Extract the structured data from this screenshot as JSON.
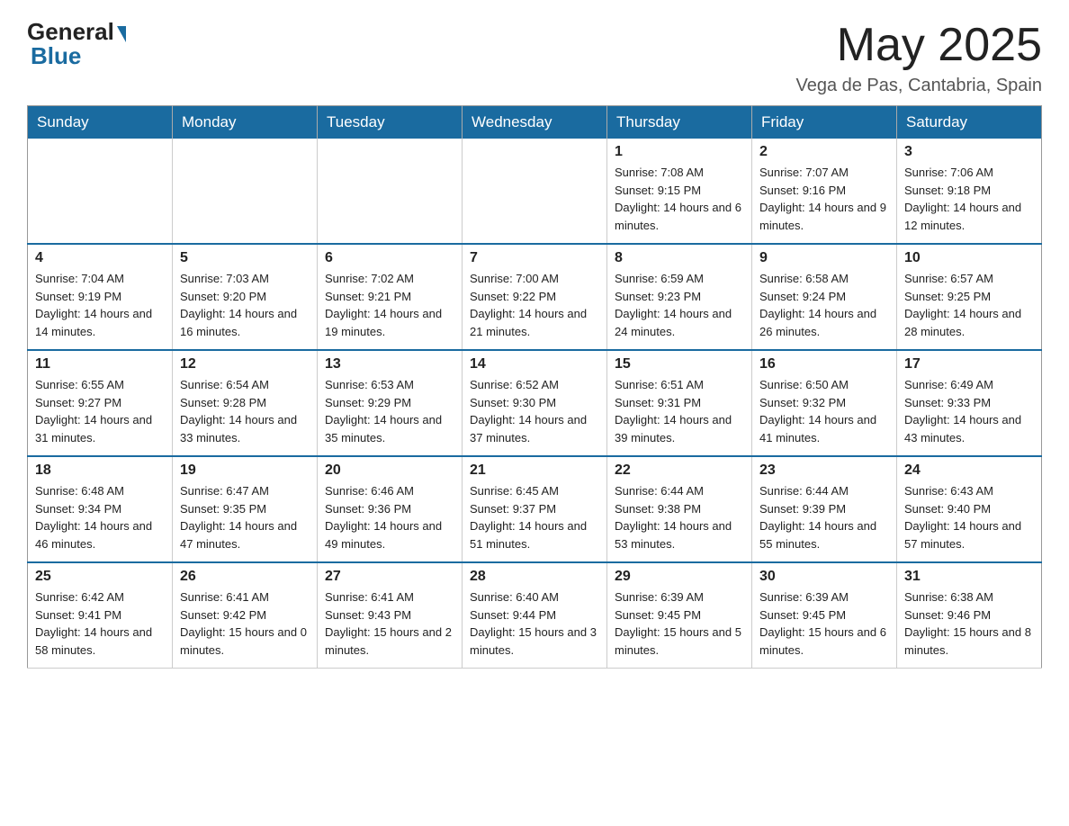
{
  "header": {
    "logo_general": "General",
    "logo_blue": "Blue",
    "main_title": "May 2025",
    "subtitle": "Vega de Pas, Cantabria, Spain"
  },
  "calendar": {
    "days_of_week": [
      "Sunday",
      "Monday",
      "Tuesday",
      "Wednesday",
      "Thursday",
      "Friday",
      "Saturday"
    ],
    "weeks": [
      [
        {
          "day": "",
          "info": ""
        },
        {
          "day": "",
          "info": ""
        },
        {
          "day": "",
          "info": ""
        },
        {
          "day": "",
          "info": ""
        },
        {
          "day": "1",
          "info": "Sunrise: 7:08 AM\nSunset: 9:15 PM\nDaylight: 14 hours and 6 minutes."
        },
        {
          "day": "2",
          "info": "Sunrise: 7:07 AM\nSunset: 9:16 PM\nDaylight: 14 hours and 9 minutes."
        },
        {
          "day": "3",
          "info": "Sunrise: 7:06 AM\nSunset: 9:18 PM\nDaylight: 14 hours and 12 minutes."
        }
      ],
      [
        {
          "day": "4",
          "info": "Sunrise: 7:04 AM\nSunset: 9:19 PM\nDaylight: 14 hours and 14 minutes."
        },
        {
          "day": "5",
          "info": "Sunrise: 7:03 AM\nSunset: 9:20 PM\nDaylight: 14 hours and 16 minutes."
        },
        {
          "day": "6",
          "info": "Sunrise: 7:02 AM\nSunset: 9:21 PM\nDaylight: 14 hours and 19 minutes."
        },
        {
          "day": "7",
          "info": "Sunrise: 7:00 AM\nSunset: 9:22 PM\nDaylight: 14 hours and 21 minutes."
        },
        {
          "day": "8",
          "info": "Sunrise: 6:59 AM\nSunset: 9:23 PM\nDaylight: 14 hours and 24 minutes."
        },
        {
          "day": "9",
          "info": "Sunrise: 6:58 AM\nSunset: 9:24 PM\nDaylight: 14 hours and 26 minutes."
        },
        {
          "day": "10",
          "info": "Sunrise: 6:57 AM\nSunset: 9:25 PM\nDaylight: 14 hours and 28 minutes."
        }
      ],
      [
        {
          "day": "11",
          "info": "Sunrise: 6:55 AM\nSunset: 9:27 PM\nDaylight: 14 hours and 31 minutes."
        },
        {
          "day": "12",
          "info": "Sunrise: 6:54 AM\nSunset: 9:28 PM\nDaylight: 14 hours and 33 minutes."
        },
        {
          "day": "13",
          "info": "Sunrise: 6:53 AM\nSunset: 9:29 PM\nDaylight: 14 hours and 35 minutes."
        },
        {
          "day": "14",
          "info": "Sunrise: 6:52 AM\nSunset: 9:30 PM\nDaylight: 14 hours and 37 minutes."
        },
        {
          "day": "15",
          "info": "Sunrise: 6:51 AM\nSunset: 9:31 PM\nDaylight: 14 hours and 39 minutes."
        },
        {
          "day": "16",
          "info": "Sunrise: 6:50 AM\nSunset: 9:32 PM\nDaylight: 14 hours and 41 minutes."
        },
        {
          "day": "17",
          "info": "Sunrise: 6:49 AM\nSunset: 9:33 PM\nDaylight: 14 hours and 43 minutes."
        }
      ],
      [
        {
          "day": "18",
          "info": "Sunrise: 6:48 AM\nSunset: 9:34 PM\nDaylight: 14 hours and 46 minutes."
        },
        {
          "day": "19",
          "info": "Sunrise: 6:47 AM\nSunset: 9:35 PM\nDaylight: 14 hours and 47 minutes."
        },
        {
          "day": "20",
          "info": "Sunrise: 6:46 AM\nSunset: 9:36 PM\nDaylight: 14 hours and 49 minutes."
        },
        {
          "day": "21",
          "info": "Sunrise: 6:45 AM\nSunset: 9:37 PM\nDaylight: 14 hours and 51 minutes."
        },
        {
          "day": "22",
          "info": "Sunrise: 6:44 AM\nSunset: 9:38 PM\nDaylight: 14 hours and 53 minutes."
        },
        {
          "day": "23",
          "info": "Sunrise: 6:44 AM\nSunset: 9:39 PM\nDaylight: 14 hours and 55 minutes."
        },
        {
          "day": "24",
          "info": "Sunrise: 6:43 AM\nSunset: 9:40 PM\nDaylight: 14 hours and 57 minutes."
        }
      ],
      [
        {
          "day": "25",
          "info": "Sunrise: 6:42 AM\nSunset: 9:41 PM\nDaylight: 14 hours and 58 minutes."
        },
        {
          "day": "26",
          "info": "Sunrise: 6:41 AM\nSunset: 9:42 PM\nDaylight: 15 hours and 0 minutes."
        },
        {
          "day": "27",
          "info": "Sunrise: 6:41 AM\nSunset: 9:43 PM\nDaylight: 15 hours and 2 minutes."
        },
        {
          "day": "28",
          "info": "Sunrise: 6:40 AM\nSunset: 9:44 PM\nDaylight: 15 hours and 3 minutes."
        },
        {
          "day": "29",
          "info": "Sunrise: 6:39 AM\nSunset: 9:45 PM\nDaylight: 15 hours and 5 minutes."
        },
        {
          "day": "30",
          "info": "Sunrise: 6:39 AM\nSunset: 9:45 PM\nDaylight: 15 hours and 6 minutes."
        },
        {
          "day": "31",
          "info": "Sunrise: 6:38 AM\nSunset: 9:46 PM\nDaylight: 15 hours and 8 minutes."
        }
      ]
    ]
  }
}
